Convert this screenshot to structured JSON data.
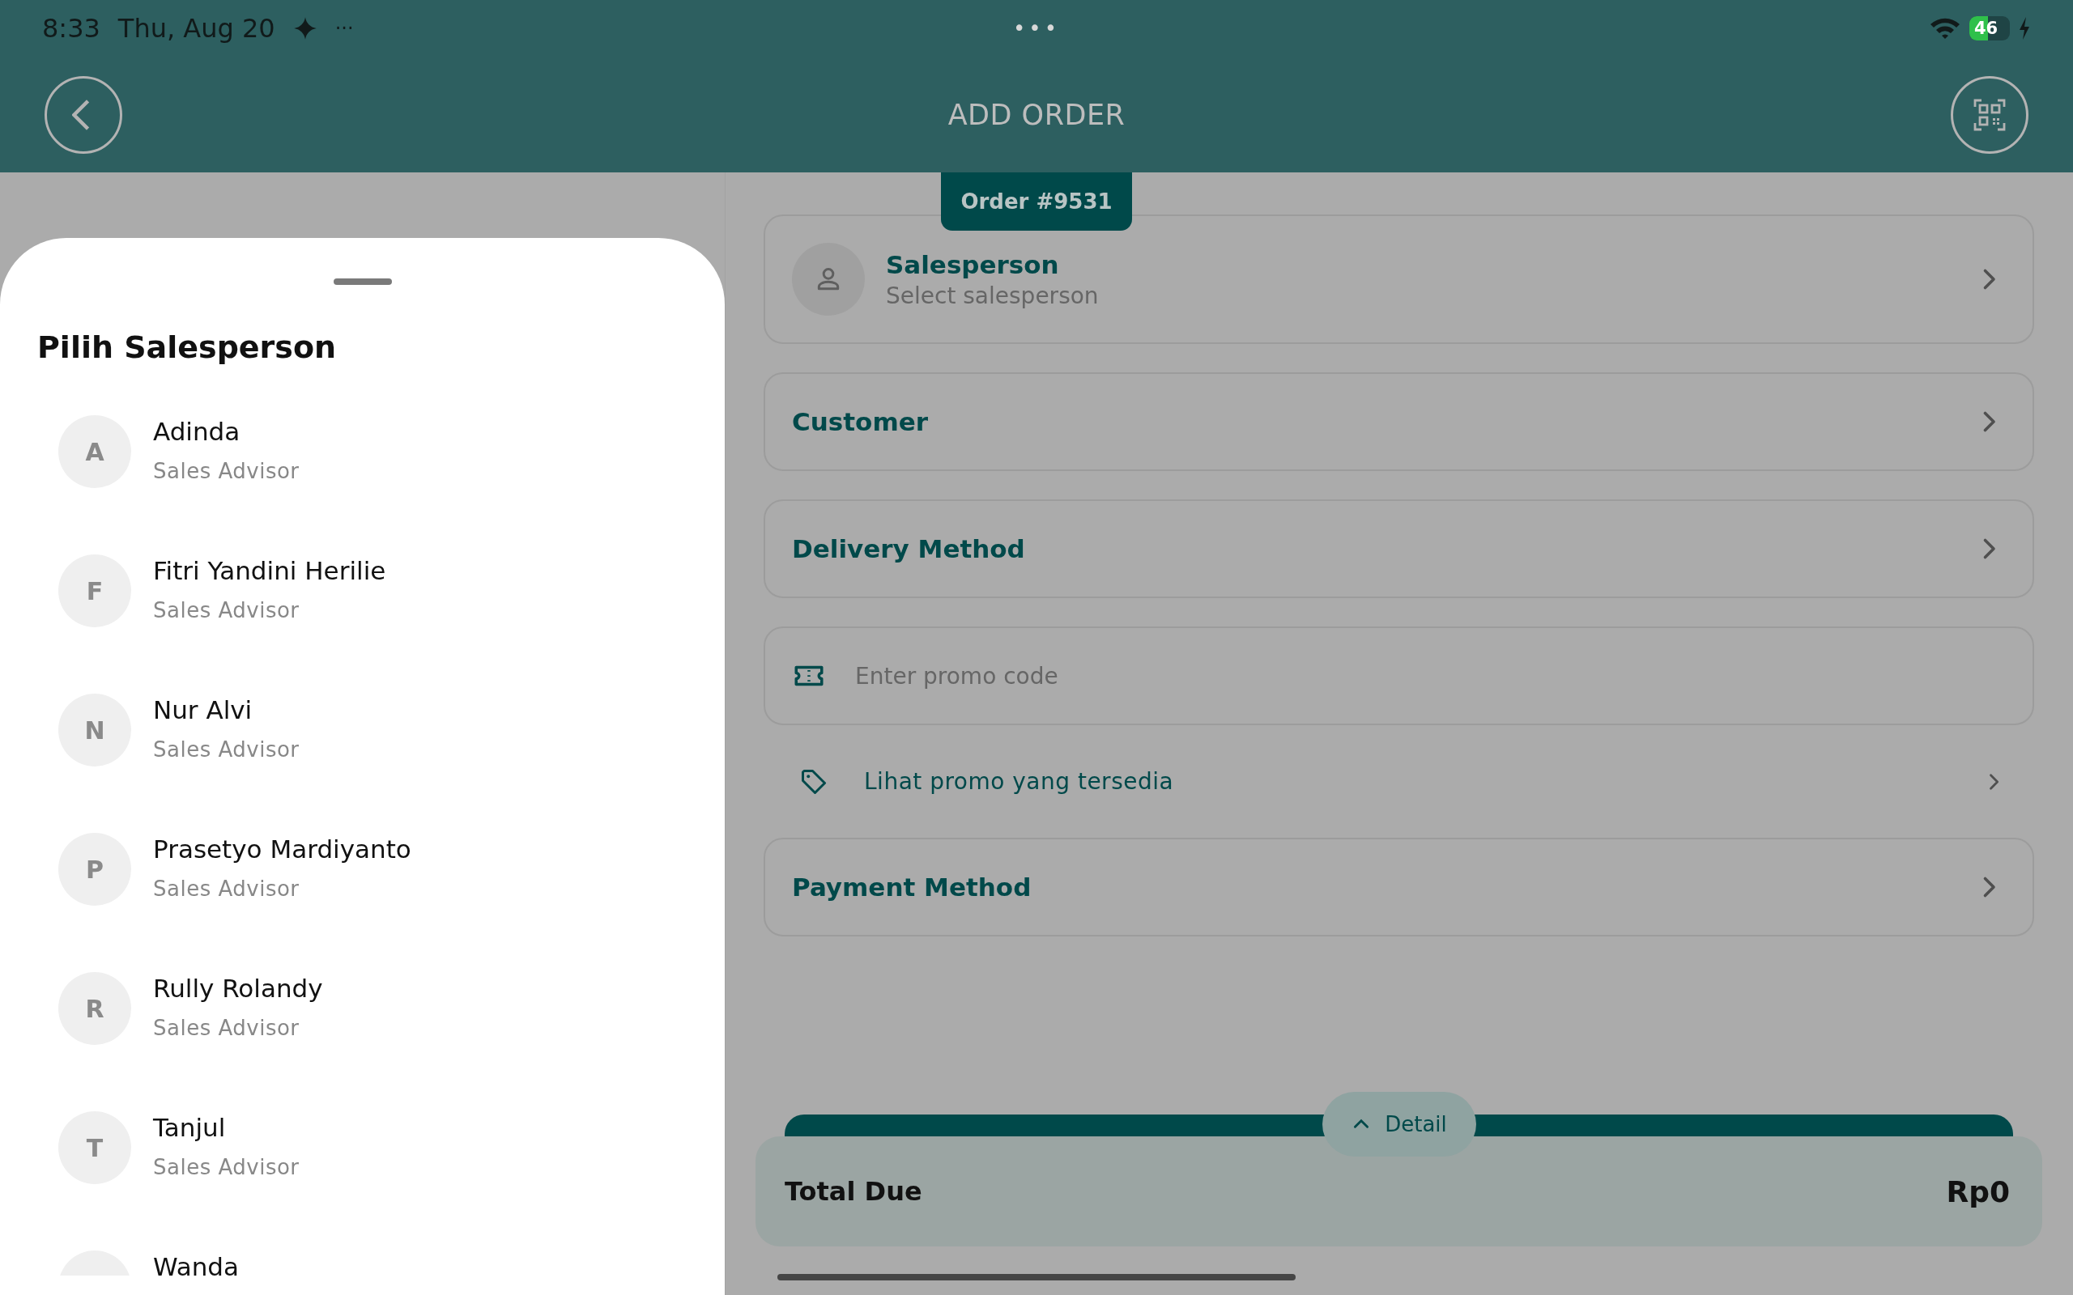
{
  "status_bar": {
    "time": "8:33",
    "date": "Thu, Aug 20",
    "more": "···",
    "center_dots": "•••",
    "battery": "46"
  },
  "header": {
    "title": "ADD ORDER"
  },
  "order_tab": "Order #9531",
  "rows": [
    {
      "kind": "person-picker",
      "label": "Salesperson",
      "placeholder": "Select salesperson"
    },
    {
      "kind": "nav",
      "label": "Customer"
    },
    {
      "kind": "nav",
      "label": "Delivery Method"
    },
    {
      "kind": "promo-field",
      "placeholder": "Enter promo code"
    },
    {
      "kind": "promo-link",
      "label": "Lihat promo yang tersedia"
    },
    {
      "kind": "nav",
      "label": "Payment Method"
    }
  ],
  "summary": {
    "detail": "Detail",
    "total_label": "Total Due",
    "total": "Rp0"
  },
  "sheet": {
    "title": "Pilih Salesperson",
    "people": [
      {
        "initial": "A",
        "name": "Adinda",
        "role": "Sales Advisor"
      },
      {
        "initial": "F",
        "name": "Fitri Yandini Herilie",
        "role": "Sales Advisor"
      },
      {
        "initial": "N",
        "name": "Nur Alvi",
        "role": "Sales Advisor"
      },
      {
        "initial": "P",
        "name": "Prasetyo Mardiyanto",
        "role": "Sales Advisor"
      },
      {
        "initial": "R",
        "name": "Rully Rolandy",
        "role": "Sales Advisor"
      },
      {
        "initial": "T",
        "name": "Tanjul",
        "role": "Sales Advisor"
      },
      {
        "name": "Wanda"
      }
    ]
  }
}
